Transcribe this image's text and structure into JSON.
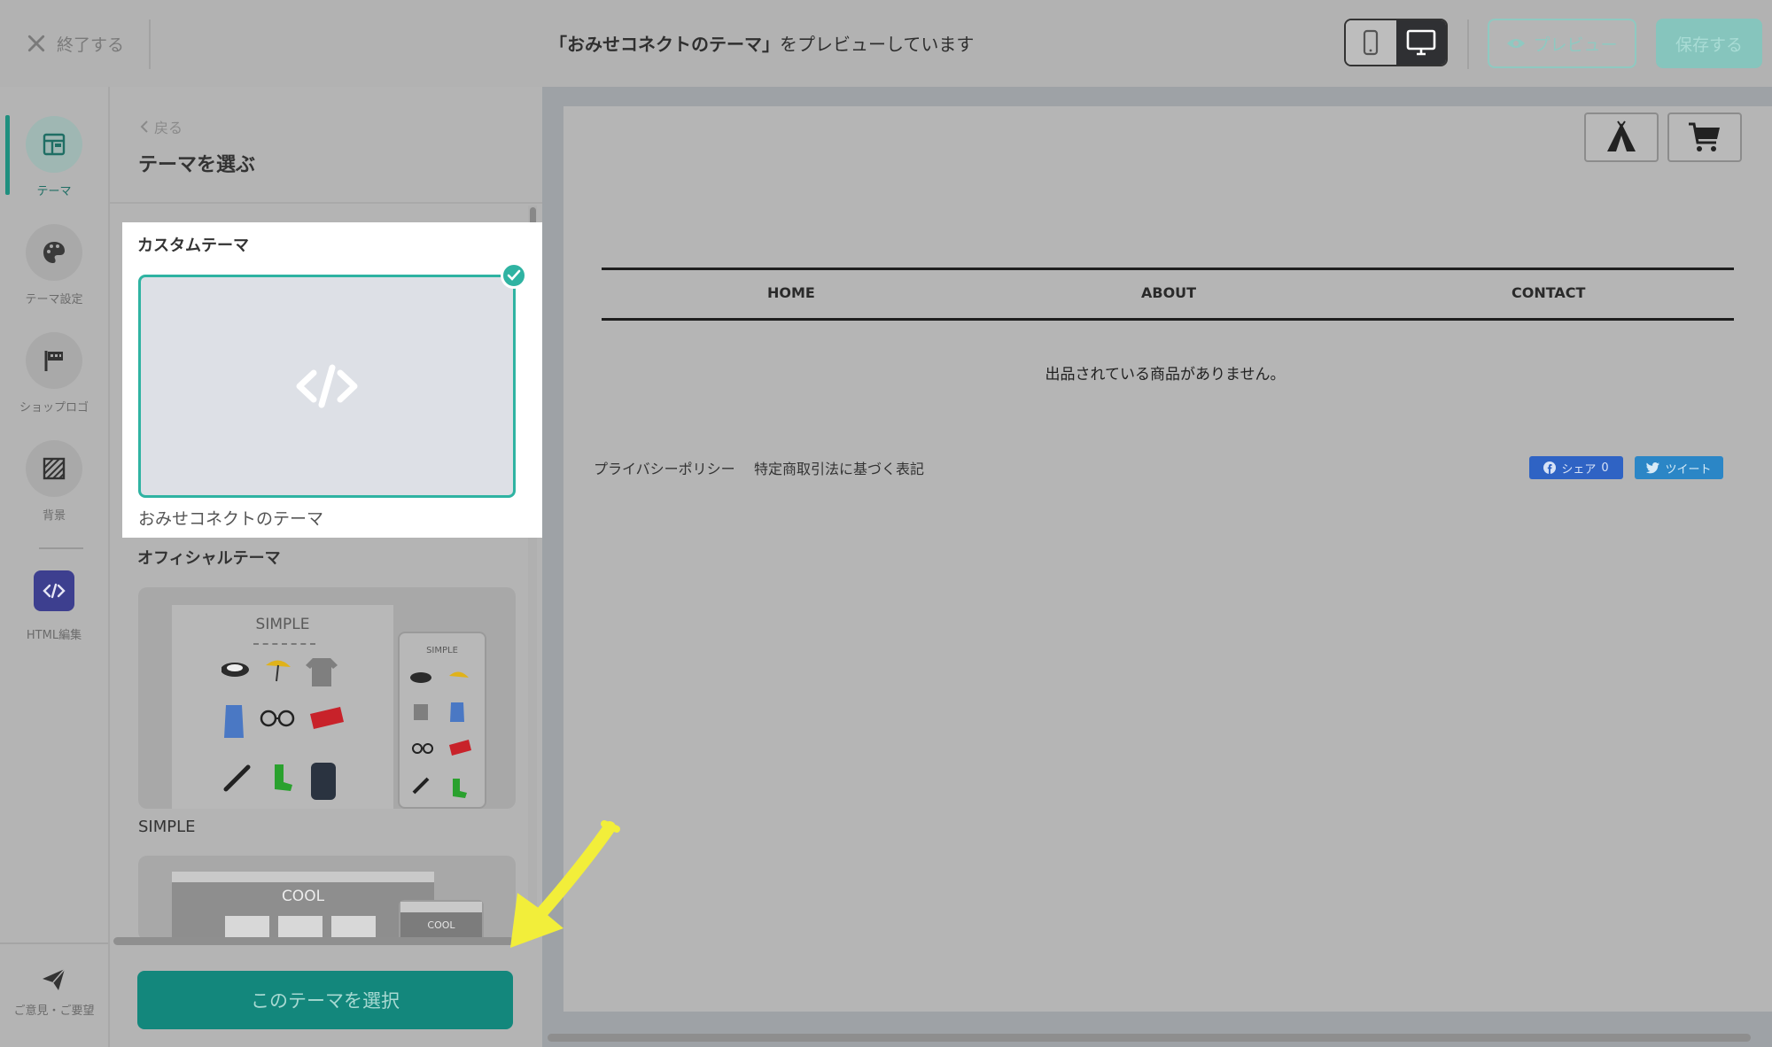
{
  "topbar": {
    "close_label": "終了する",
    "preview_title_quoted": "「おみせコネクトのテーマ」",
    "preview_title_suffix": "をプレビューしています",
    "preview_button": "プレビュー",
    "save_button": "保存する"
  },
  "rail": {
    "items": [
      {
        "label": "テーマ",
        "icon": "layout-icon"
      },
      {
        "label": "テーマ設定",
        "icon": "palette-icon"
      },
      {
        "label": "ショップロゴ",
        "icon": "flag-icon"
      },
      {
        "label": "背景",
        "icon": "texture-icon"
      },
      {
        "label": "HTML編集",
        "icon": "code-icon"
      }
    ],
    "feedback_label": "ご意見・ご要望"
  },
  "panel": {
    "back_label": "戻る",
    "title": "テーマを選ぶ",
    "custom_heading": "カスタムテーマ",
    "custom_theme_name": "おみせコネクトのテーマ",
    "official_heading": "オフィシャルテーマ",
    "themes": [
      {
        "name": "SIMPLE",
        "thumb_title": "SIMPLE"
      },
      {
        "thumb_title": "COOL"
      }
    ],
    "select_button": "このテーマを選択"
  },
  "preview": {
    "nav": [
      "HOME",
      "ABOUT",
      "CONTACT"
    ],
    "empty_message": "出品されている商品がありません。",
    "footer_links": [
      "プライバシーポリシー",
      "特定商取引法に基づく表記"
    ],
    "share_label": "シェア",
    "share_count": "0",
    "tweet_label": "ツイート"
  },
  "colors": {
    "accent": "#2fb3a2",
    "select_button": "#13877c",
    "html_edit": "#3d3f8f",
    "facebook": "#2f63c4",
    "twitter": "#2b86c6",
    "annotation_arrow": "#f2ee3a"
  }
}
